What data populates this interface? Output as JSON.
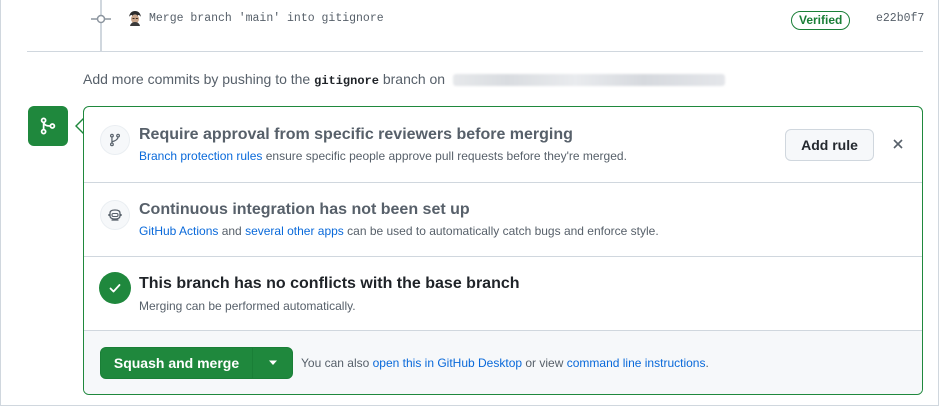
{
  "commit": {
    "message": "Merge branch 'main' into gitignore",
    "verified_label": "Verified",
    "sha": "e22b0f7"
  },
  "hint": {
    "prefix": "Add more commits by pushing to the",
    "branch": "gitignore",
    "suffix": "branch on"
  },
  "reviewers": {
    "title": "Require approval from specific reviewers before merging",
    "link": "Branch protection rules",
    "desc": " ensure specific people approve pull requests before they're merged.",
    "add_rule_label": "Add rule"
  },
  "ci": {
    "title": "Continuous integration has not been set up",
    "link1": "GitHub Actions",
    "mid": " and ",
    "link2": "several other apps",
    "desc": " can be used to automatically catch bugs and enforce style."
  },
  "conflicts": {
    "title": "This branch has no conflicts with the base branch",
    "desc": "Merging can be performed automatically."
  },
  "footer": {
    "merge_label": "Squash and merge",
    "text1": "You can also ",
    "link1": "open this in GitHub Desktop",
    "text2": " or view ",
    "link2": "command line instructions",
    "text3": "."
  },
  "colors": {
    "success": "#1f883d",
    "link": "#0969da",
    "muted": "#57606a"
  },
  "icons": [
    "git-commit-icon",
    "avatar",
    "git-merge-icon",
    "git-branch-icon",
    "ci-robot-icon",
    "close-icon",
    "check-icon",
    "triangle-down-icon"
  ]
}
